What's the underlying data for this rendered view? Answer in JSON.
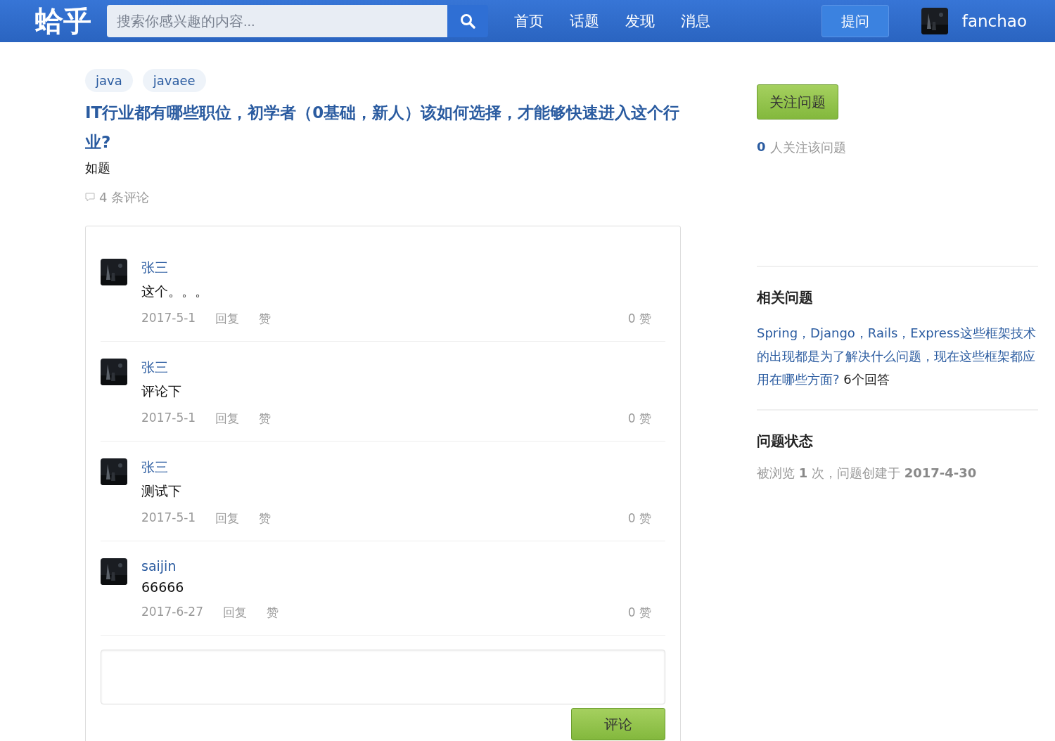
{
  "header": {
    "logo": "蛤乎",
    "search": {
      "placeholder": "搜索你感兴趣的内容..."
    },
    "nav": [
      {
        "label": "首页"
      },
      {
        "label": "话题"
      },
      {
        "label": "发现"
      },
      {
        "label": "消息"
      }
    ],
    "ask_button": "提问",
    "user": {
      "name": "fanchao"
    }
  },
  "question": {
    "tags": [
      "java",
      "javaee"
    ],
    "title": "IT行业都有哪些职位，初学者（0基础，新人）该如何选择，才能够快速进入这个行业?",
    "body": "如题",
    "comment_count": "4 条评论"
  },
  "comments": [
    {
      "author": "张三",
      "text": "这个。。。",
      "date": "2017-5-1",
      "reply": "回复",
      "like": "赞",
      "likes": "0 赞"
    },
    {
      "author": "张三",
      "text": "评论下",
      "date": "2017-5-1",
      "reply": "回复",
      "like": "赞",
      "likes": "0 赞"
    },
    {
      "author": "张三",
      "text": "测试下",
      "date": "2017-5-1",
      "reply": "回复",
      "like": "赞",
      "likes": "0 赞"
    },
    {
      "author": "saijin",
      "text": "66666",
      "date": "2017-6-27",
      "reply": "回复",
      "like": "赞",
      "likes": "0 赞"
    }
  ],
  "comment_button": "评论",
  "sidebar": {
    "follow_button": "关注问题",
    "follow_count": "0",
    "follow_label": "人关注该问题",
    "related": {
      "title": "相关问题",
      "items": [
        {
          "question": "Spring，Django，Rails，Express这些框架技术的出现都是为了解决什么问题，现在这些框架都应用在哪些方面?",
          "answers": "6个回答"
        }
      ]
    },
    "status": {
      "title": "问题状态",
      "text": "被浏览 **1** 次，问题创建于 **2017-4-30**"
    }
  }
}
